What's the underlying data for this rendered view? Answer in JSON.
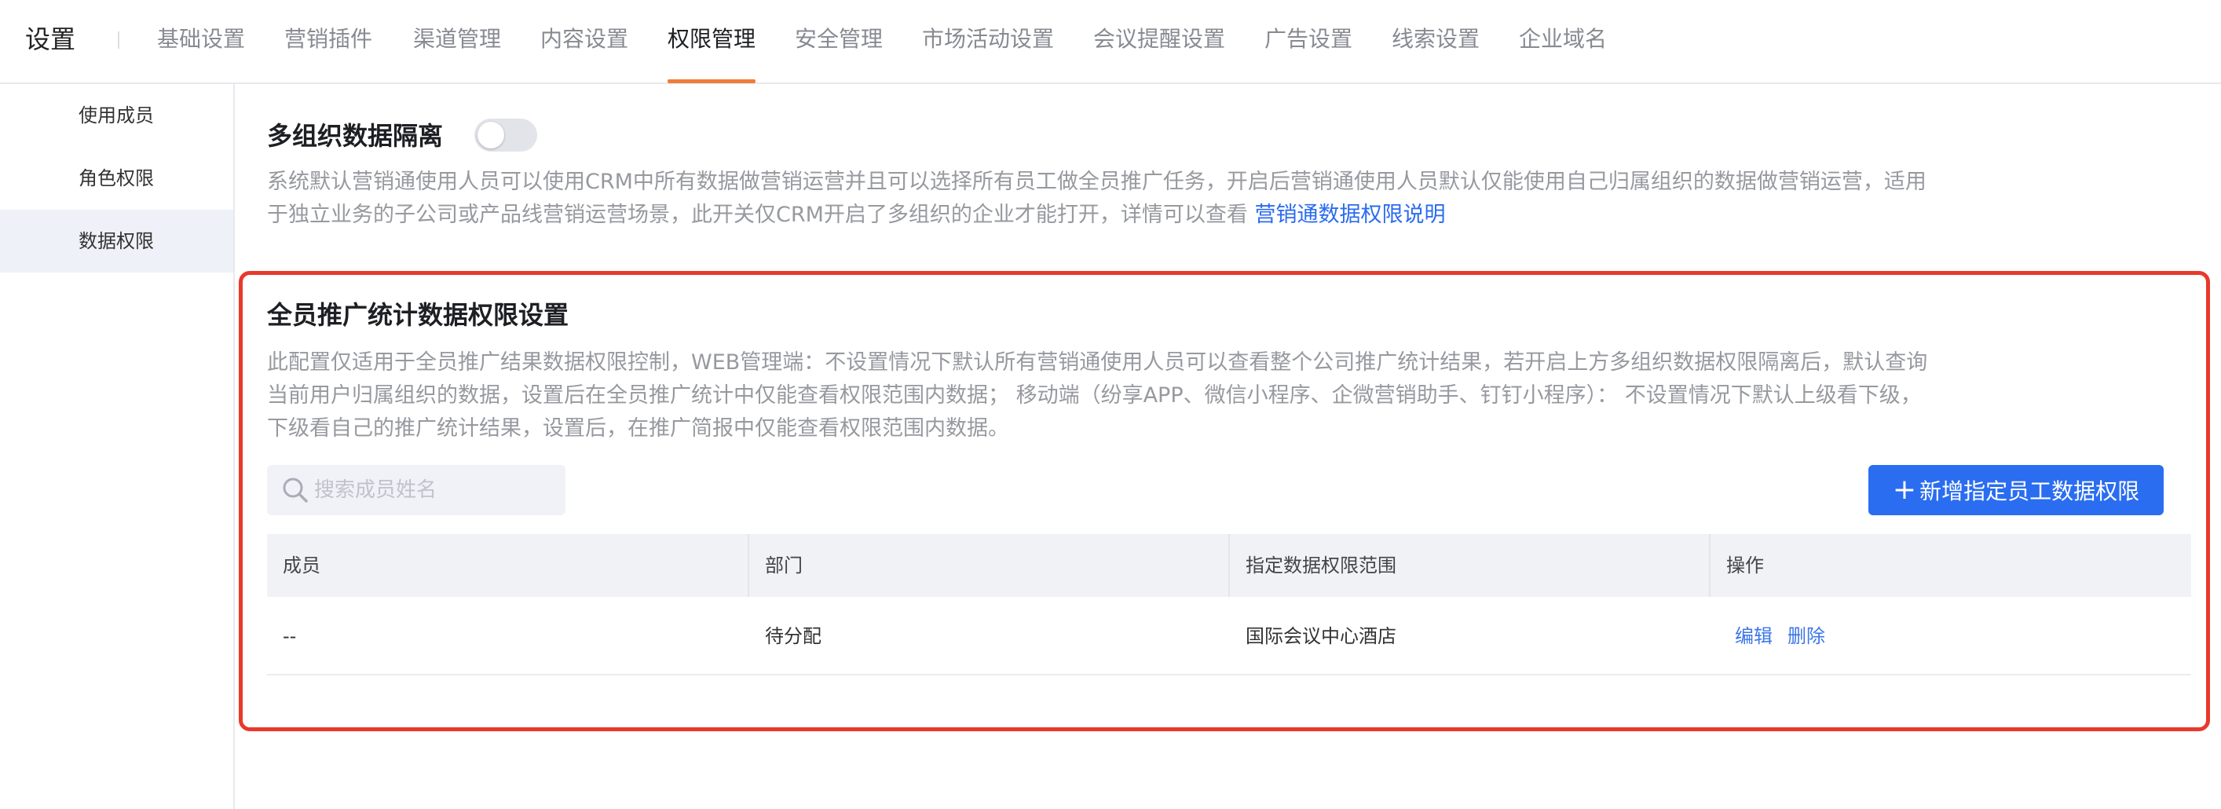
{
  "app": {
    "title": "设置"
  },
  "tabs": [
    {
      "label": "基础设置"
    },
    {
      "label": "营销插件"
    },
    {
      "label": "渠道管理"
    },
    {
      "label": "内容设置"
    },
    {
      "label": "权限管理",
      "active": true
    },
    {
      "label": "安全管理"
    },
    {
      "label": "市场活动设置"
    },
    {
      "label": "会议提醒设置"
    },
    {
      "label": "广告设置"
    },
    {
      "label": "线索设置"
    },
    {
      "label": "企业域名"
    }
  ],
  "sidebar": {
    "items": [
      {
        "label": "使用成员"
      },
      {
        "label": "角色权限"
      },
      {
        "label": "数据权限",
        "active": true
      }
    ]
  },
  "section1": {
    "title": "多组织数据隔离",
    "toggle_on": false,
    "desc_line1": "系统默认营销通使用人员可以使用CRM中所有数据做营销运营并且可以选择所有员工做全员推广任务，开启后营销通使用人员默认仅能使用自己归属组织的数据做营销运营，适用",
    "desc_line2": "于独立业务的子公司或产品线营销运营场景，此开关仅CRM开启了多组织的企业才能打开，详情可以查看 ",
    "link_text": "营销通数据权限说明"
  },
  "section2": {
    "title": "全员推广统计数据权限设置",
    "desc_line1": "此配置仅适用于全员推广结果数据权限控制，WEB管理端：不设置情况下默认所有营销通使用人员可以查看整个公司推广统计结果，若开启上方多组织数据权限隔离后，默认查询",
    "desc_line2": "当前用户归属组织的数据，设置后在全员推广统计中仅能查看权限范围内数据； 移动端（纷享APP、微信小程序、企微营销助手、钉钉小程序）： 不设置情况下默认上级看下级，",
    "desc_line3": "下级看自己的推广统计结果，设置后，在推广简报中仅能查看权限范围内数据。",
    "search": {
      "placeholder": "搜索成员姓名",
      "value": ""
    },
    "add_button": {
      "icon": "plus-icon",
      "label": "新增指定员工数据权限"
    },
    "table": {
      "columns": [
        "成员",
        "部门",
        "指定数据权限范围",
        "操作"
      ],
      "rows": [
        {
          "member": "--",
          "dept": "待分配",
          "scope": "国际会议中心酒店",
          "edit": "编辑",
          "delete": "删除"
        }
      ]
    }
  },
  "colors": {
    "accent_orange": "#f07d3a",
    "primary_blue": "#2a6df1",
    "link_blue": "#2b6bf0",
    "highlight_red": "#e8392b"
  },
  "icons": {
    "search": "search-icon"
  }
}
